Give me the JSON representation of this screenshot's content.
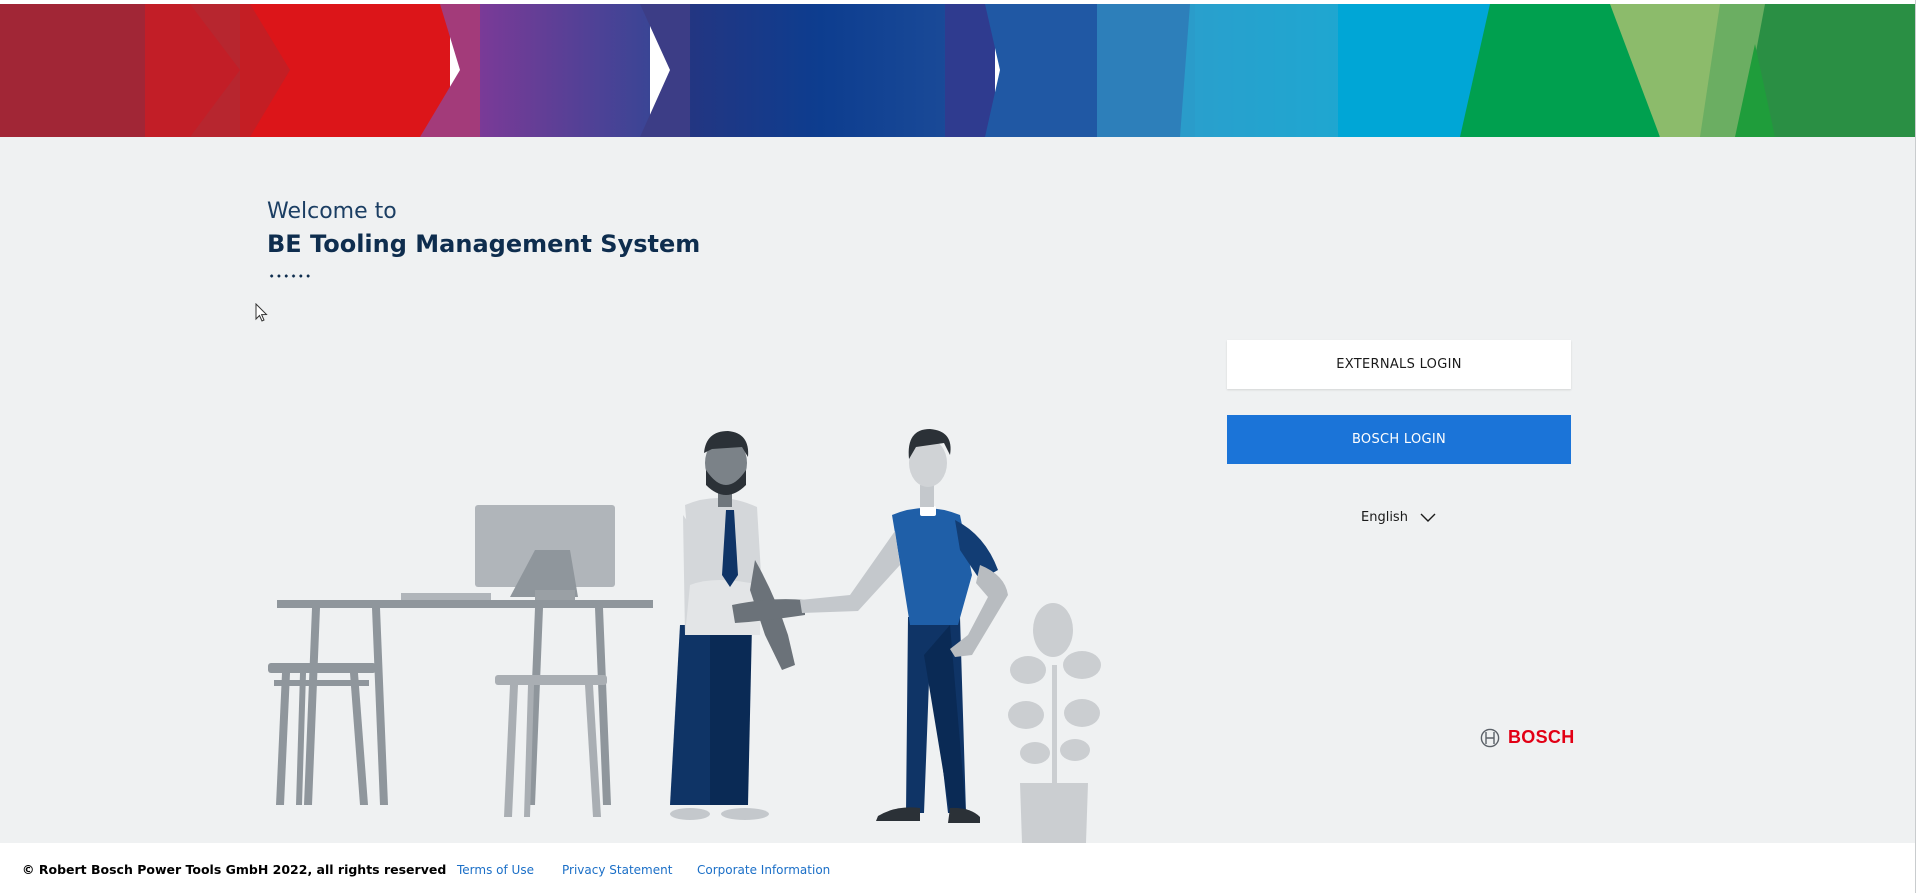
{
  "welcome": {
    "greeting": "Welcome to",
    "title": "BE Tooling Management System"
  },
  "login": {
    "externals_label": "EXTERNALS LOGIN",
    "bosch_label": "BOSCH LOGIN"
  },
  "language": {
    "selected": "English"
  },
  "brand": {
    "name": "BOSCH",
    "icon": "bosch-armature-icon",
    "color": "#e20015"
  },
  "footer": {
    "copyright": "© Robert Bosch Power Tools GmbH 2022, all rights reserved",
    "links": [
      "Terms of Use",
      "Privacy Statement",
      "Corporate Information"
    ]
  },
  "colors": {
    "primary_button": "#1b74d8",
    "title_text": "#0e2d4e",
    "link": "#1b6fc7",
    "background": "#eff1f2"
  }
}
